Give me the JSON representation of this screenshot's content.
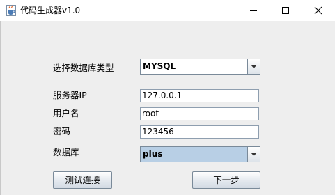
{
  "window": {
    "title": "代码生成器v1.0",
    "icon": "java-cup-icon",
    "controls": [
      "minimize-icon",
      "maximize-icon",
      "close-icon"
    ]
  },
  "form": {
    "db_type_label": "选择数据库类型",
    "db_type_value": "MYSQL",
    "server_ip_label": "服务器IP",
    "server_ip_value": "127.0.0.1",
    "username_label": "用户名",
    "username_value": "root",
    "password_label": "密码",
    "password_value": "123456",
    "database_label": "数据库",
    "database_value": "plus"
  },
  "buttons": {
    "test_connection": "测试连接",
    "next": "下一步"
  },
  "colors": {
    "background": "#EEEEEE",
    "titlebar": "#FFFFFF",
    "selected_combo": "#B8CFE5",
    "border": "#7A8A99"
  }
}
